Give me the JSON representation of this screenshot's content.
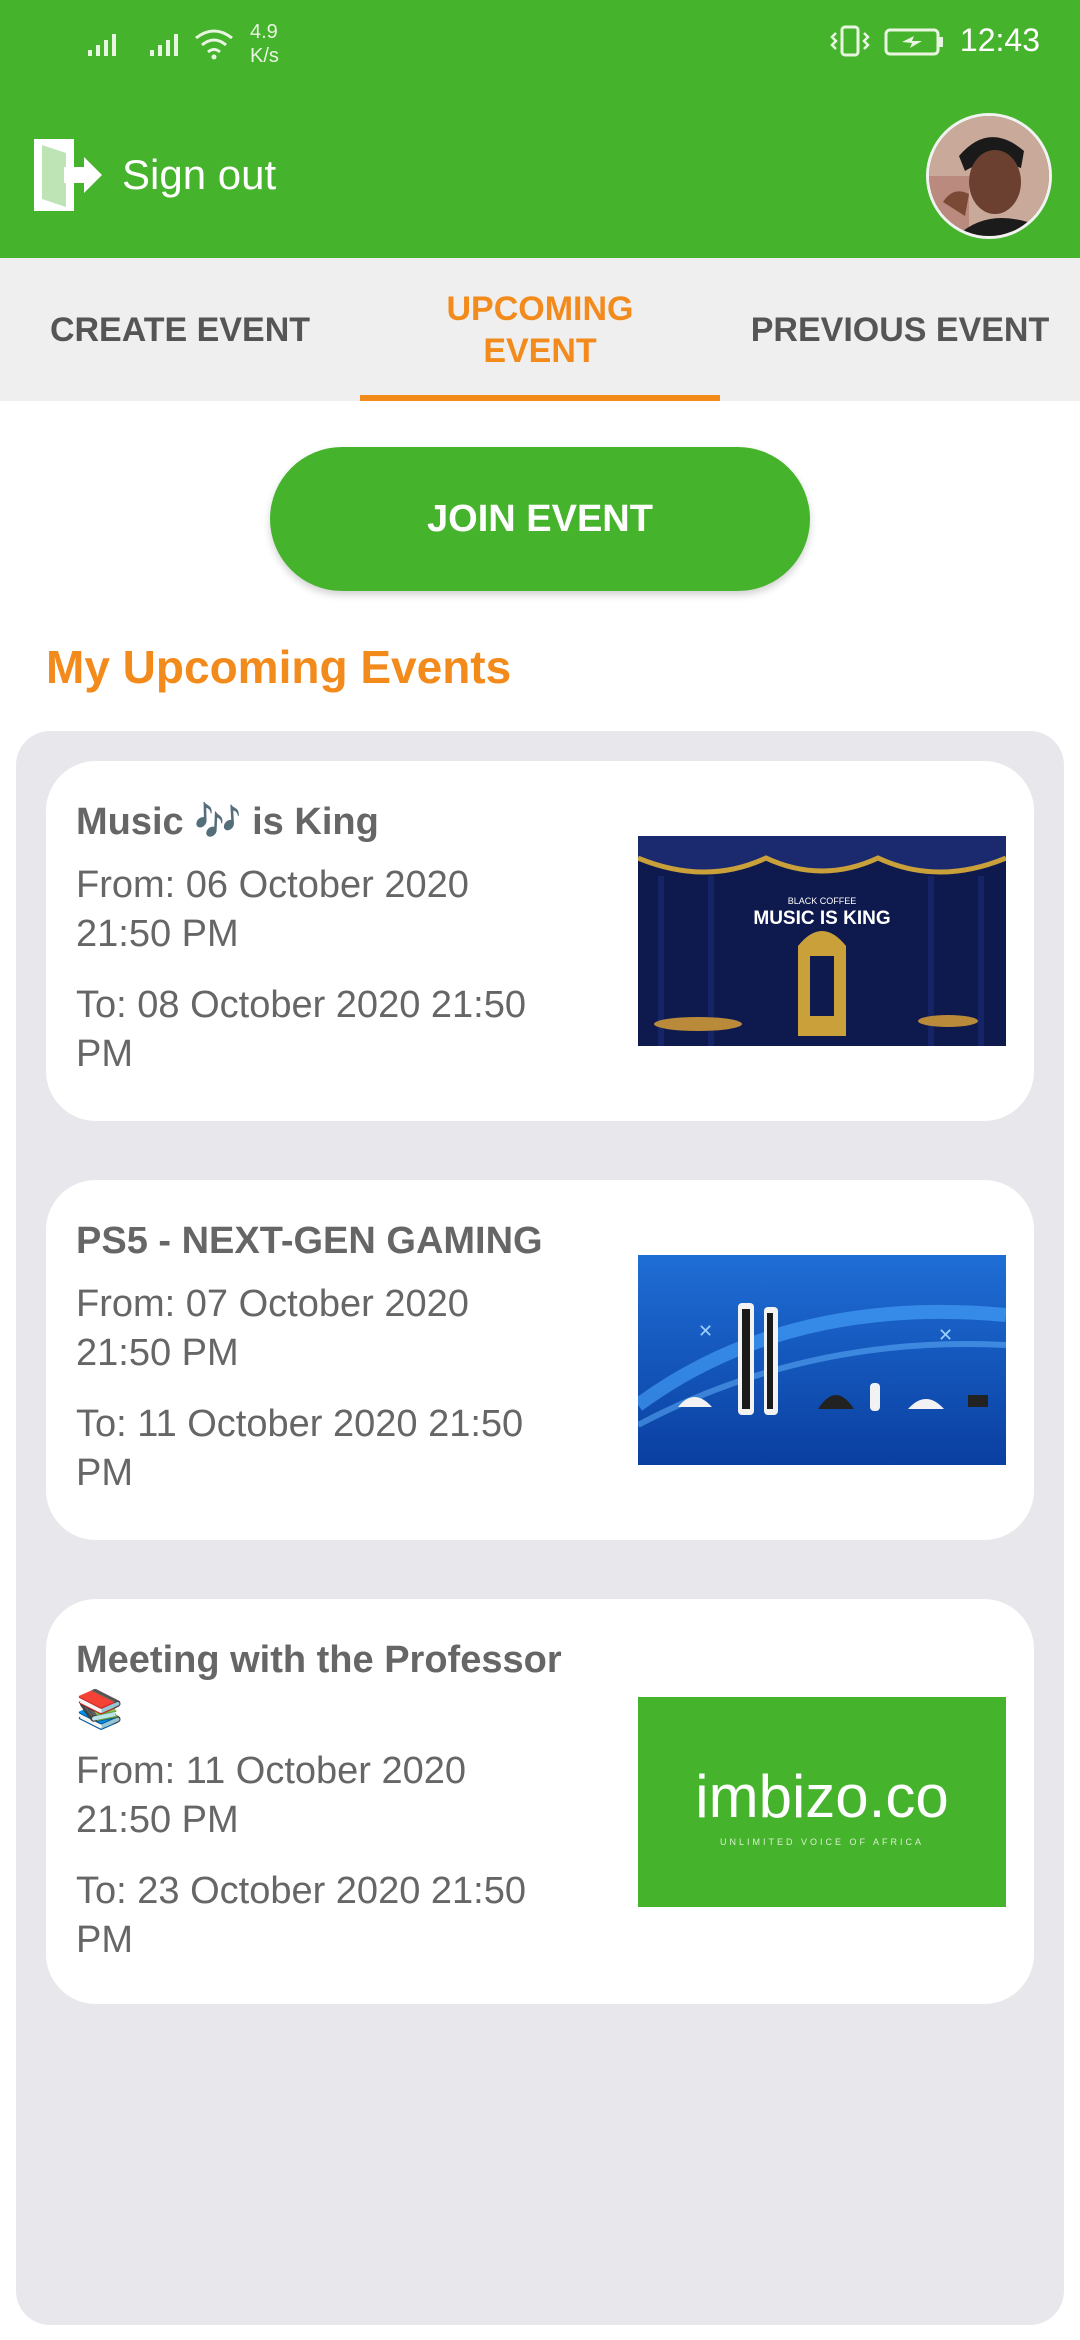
{
  "status_bar": {
    "net_speed_value": "4.9",
    "net_speed_unit": "K/s",
    "time": "12:43"
  },
  "header": {
    "signout_label": "Sign out",
    "colors": {
      "brand_green": "#46b32c",
      "accent_orange": "#f28a1c"
    }
  },
  "tabs": [
    {
      "label_line1": "CREATE EVENT",
      "label_line2": "",
      "active": false
    },
    {
      "label_line1": "UPCOMING",
      "label_line2": "EVENT",
      "active": true
    },
    {
      "label_line1": "PREVIOUS EVENT",
      "label_line2": "",
      "active": false
    }
  ],
  "join_button_label": "JOIN EVENT",
  "section_title": "My Upcoming Events",
  "events": [
    {
      "title": "Music 🎶 is King",
      "from_line1": "From: 06 October 2020",
      "from_line2": "21:50 PM",
      "to_line1": "To: 08 October 2020 21:50",
      "to_line2": "PM",
      "thumb_caption_small": "BLACK COFFEE",
      "thumb_caption_big": "MUSIC IS KING"
    },
    {
      "title": "PS5 - NEXT-GEN GAMING",
      "from_line1": "From: 07 October 2020",
      "from_line2": "21:50 PM",
      "to_line1": "To: 11 October 2020 21:50",
      "to_line2": "PM"
    },
    {
      "title": "Meeting with the Professor 📚",
      "from_line1": "From: 11 October 2020",
      "from_line2": "21:50 PM",
      "to_line1": "To: 23 October 2020 21:50",
      "to_line2": "PM",
      "thumb_logo": "imbizo.co",
      "thumb_tagline": "UNLIMITED VOICE OF AFRICA"
    }
  ]
}
